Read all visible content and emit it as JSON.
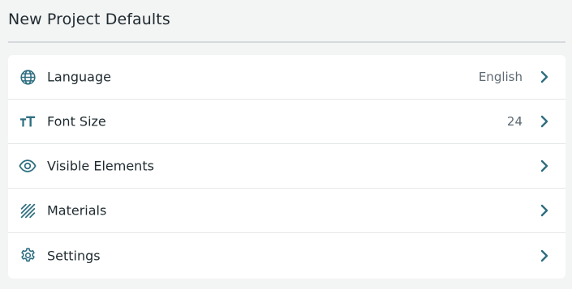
{
  "header": {
    "title": "New Project Defaults"
  },
  "colors": {
    "accent": "#2e6e80",
    "background": "#f3f4f4",
    "card": "#ffffff",
    "divider": "#e4e7e8"
  },
  "rows": [
    {
      "label": "Language",
      "value": "English",
      "icon": "globe-icon"
    },
    {
      "label": "Font Size",
      "value": "24",
      "icon": "text-size-icon"
    },
    {
      "label": "Visible Elements",
      "value": "",
      "icon": "eye-icon"
    },
    {
      "label": "Materials",
      "value": "",
      "icon": "hatch-pattern-icon"
    },
    {
      "label": "Settings",
      "value": "",
      "icon": "gear-icon"
    }
  ]
}
